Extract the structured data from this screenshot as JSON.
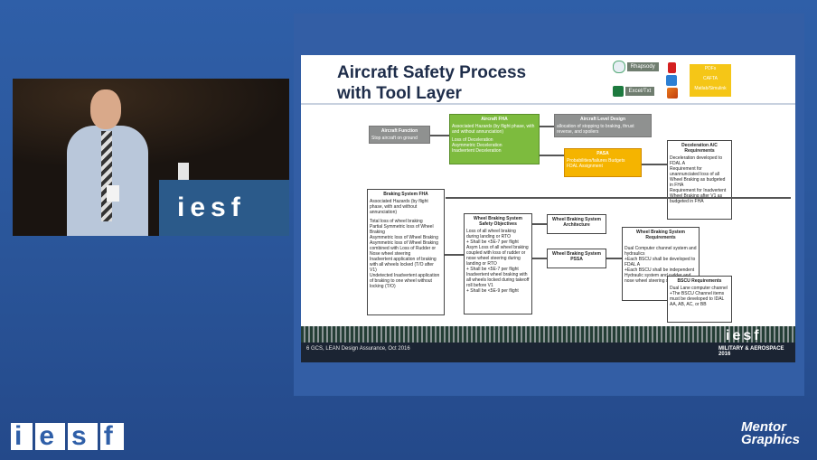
{
  "slide": {
    "title_line1": "Aircraft Safety Process",
    "title_line2": "with Tool Layer",
    "tools": {
      "rhapsody": "Rhapsody",
      "excel": "Excel/Txt",
      "yellow": [
        "PDFs",
        "CAFTA",
        "Matlab/Simulink"
      ]
    },
    "boxes": {
      "aircraft_function": {
        "h": "Aircraft Function",
        "t": "Stop aircraft on ground"
      },
      "aircraft_fha": {
        "h": "Aircraft FHA",
        "t": "Associated Hazards (by flight phase, with and without annunciation)",
        "items": [
          "Loss of Deceleration",
          "Asymmetric Deceleration",
          "Inadvertent Deceleration"
        ]
      },
      "aircraft_level_design": {
        "h": "Aircraft Level Design",
        "t": "allocation of stopping to braking, thrust reverse, and spoilers"
      },
      "pasa": {
        "h": "PASA",
        "items": [
          "Probabilities/failures Budgets",
          "FDAL Assignment"
        ]
      },
      "decel_requirements": {
        "h": "Deceleration A/C Requirements",
        "items": [
          "Deceleration developed to FDAL A",
          "Requirement for unannunciated loss of all Wheel Braking as budgeted in FHA",
          "Requirement for Inadvertent Wheel Braking after V1 as budgeted in FHA"
        ]
      },
      "braking_fha": {
        "h": "Braking System FHA",
        "t": "Associated Hazards (by flight phase, with and without annunciation)",
        "items": [
          "Total loss of wheel braking",
          "Partial Symmetric loss of Wheel Braking",
          "Asymmetric loss of Wheel Braking",
          "Asymmetric loss of Wheel Braking combined with Loss of Rudder or Nose wheel steering",
          "Inadvertent application of braking with all wheels locked (T/O after V1)",
          "Undetected Inadvertent application of braking to one wheel without locking (T/O)"
        ]
      },
      "wbs_objectives": {
        "h": "Wheel Braking System Safety Objectives",
        "items": [
          "Loss of all wheel braking during landing or RTO",
          "+ Shall be <5E-7 per flight",
          "Asym Loss of all wheel braking coupled with loss of rudder or nose wheel steering during landing or RTO",
          "+ Shall be <5E-7 per flight",
          "Inadvertent wheel braking with all wheels locked during takeoff roll before V1",
          "+ Shall be <5E-9 per flight"
        ]
      },
      "wbs_architecture": {
        "h": "Wheel Braking System Architecture"
      },
      "wbs_pssa": {
        "h": "Wheel Braking System PSSA"
      },
      "wbs_requirements": {
        "h": "Wheel Braking System Requirements",
        "items": [
          "Dual Computer channel system and hydraulics",
          "+Each BSCU shall be developed to FDAL A",
          "+Each BSCU shall be independent",
          "Hydraulic system and rudder and nose wheel steering system"
        ]
      },
      "bscu_requirements": {
        "h": "BSCU Requirements",
        "items": [
          "Dual Lane computer channel",
          "+The BSCU Channel items must be developed to IDAL AA, AB, AC, or BB"
        ]
      }
    },
    "footer_text": "6    GCS, LEAN Design Assurance, Oct 2016",
    "footer_logo": "iesf",
    "footer_sub": "MILITARY & AEROSPACE 2016"
  },
  "speaker": {
    "podium_label": "iesf"
  },
  "bottom": {
    "logo_letters": [
      "i",
      "e",
      "s",
      "f"
    ],
    "mentor_line1": "Mentor",
    "mentor_line2": "Graphics"
  }
}
